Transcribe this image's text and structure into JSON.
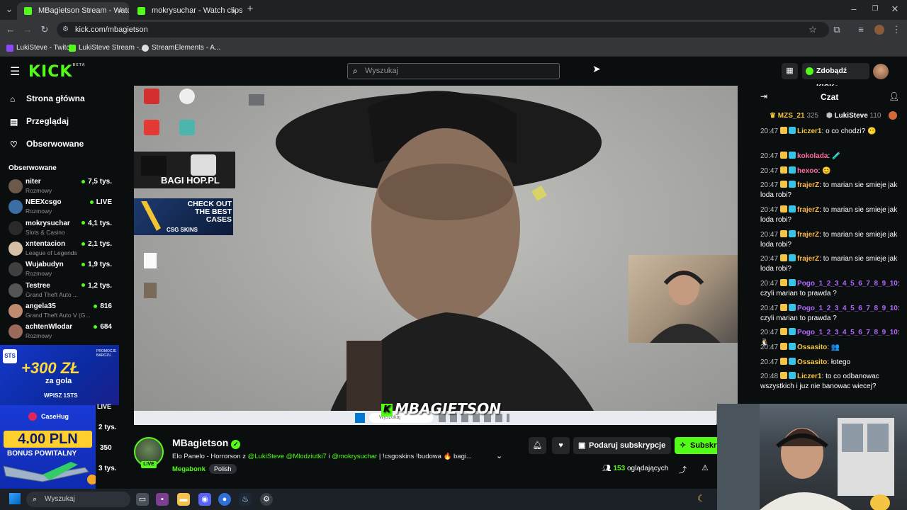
{
  "browser": {
    "tabs": [
      {
        "title": "MBagietson Stream - Watch Liv",
        "active": true
      },
      {
        "title": "mokrysuchar - Watch clips on K",
        "active": false
      }
    ],
    "url": "kick.com/mbagietson",
    "bookmarks": [
      "LukiSteve - Twitch",
      "LukiSteve Stream -...",
      "StreamElements - A..."
    ]
  },
  "header": {
    "logo": "KICK",
    "logo_sup": "BETA",
    "search_placeholder": "Wyszukaj",
    "get_kicks": "Zdobądź KICKs"
  },
  "sidebar": {
    "nav": [
      {
        "label": "Strona główna",
        "icon": "home-icon"
      },
      {
        "label": "Przeglądaj",
        "icon": "browse-icon"
      },
      {
        "label": "Obserwowane",
        "icon": "heart-icon"
      }
    ],
    "followed_title": "Obserwowane",
    "followed": [
      {
        "name": "niter",
        "category": "Rozmowy",
        "viewers": "7,5 tys.",
        "color": "#6b5a4a"
      },
      {
        "name": "NEEXcsgo",
        "category": "Rozmowy",
        "viewers": "LIVE",
        "color": "#3a6ea5"
      },
      {
        "name": "mokrysuchar",
        "category": "Slots & Casino",
        "viewers": "4,1 tys.",
        "color": "#2a2a2a"
      },
      {
        "name": "xntentacion",
        "category": "League of Legends",
        "viewers": "2,1 tys.",
        "color": "#d8c0a8"
      },
      {
        "name": "Wujabudyn",
        "category": "Rozmowy",
        "viewers": "1,9 tys.",
        "color": "#404040"
      },
      {
        "name": "Testree",
        "category": "Grand Theft Auto ...",
        "viewers": "1,2 tys.",
        "color": "#555555"
      },
      {
        "name": "angela35",
        "category": "Grand Theft Auto V (G...",
        "viewers": "816",
        "color": "#c08a70"
      },
      {
        "name": "achtenWlodar",
        "category": "Rozmowy",
        "viewers": "684",
        "color": "#9a6b5a"
      }
    ],
    "partial_viewers": [
      "LIVE",
      "2 tys.",
      "350",
      "3 tys."
    ]
  },
  "ads": {
    "ad1_headline": "+300 ZŁ",
    "ad1_sub": "za gola",
    "ad1_code": "WPISZ 1STS",
    "ad1_promo": "PROMOCJE BAROZU",
    "ad2_brand": "CaseHug",
    "ad2_amount": "4.00 PLN",
    "ad2_sub": "BONUS POWITALNY"
  },
  "video": {
    "overlay_name": "MBAGIETSON",
    "desktop_ad_shop": "BAGI HOP.PL",
    "desktop_ad_cases": "CHECK OUT THE BEST CASES",
    "desktop_ad_brand": "CSG SKINS",
    "inner_search": "Wyszukaj"
  },
  "stream": {
    "name": "MBagietson",
    "live": "LIVE",
    "title_pre": "Elo Panelo - Horrorson z ",
    "title_mentions": "@LukiSteve @Mlodziutki7",
    "title_mid": " i ",
    "title_mention2": "@mokrysuchar",
    "title_post": " | !csgoskins !budowa 🔥 bagi...",
    "category": "Megabonk",
    "language": "Polish",
    "gift_sub": "Podaruj subskrypcje",
    "subscribe": "Subskrybuj",
    "viewers_count": "153",
    "viewers_label": "oglądających"
  },
  "chat": {
    "title": "Czat",
    "pinned": [
      {
        "name": "MZS_21",
        "count": "325",
        "color": "#f5c542"
      },
      {
        "name": "LukiSteve",
        "count": "110",
        "color": "#e8e8e8"
      }
    ],
    "messages": [
      {
        "time": "20:47",
        "user": "Liczer1",
        "color": "#f5c542",
        "text": "o co chodzi? 😶"
      },
      {
        "time": "20:47",
        "user": "kokolada",
        "color": "#ff6b9d",
        "text": "🧪"
      },
      {
        "time": "20:47",
        "user": "hexoo",
        "color": "#ff6b9d",
        "text": "😊"
      },
      {
        "time": "20:47",
        "user": "frajerZ",
        "color": "#ffb347",
        "text": "to marian sie smieje jak loda robi?"
      },
      {
        "time": "20:47",
        "user": "frajerZ",
        "color": "#ffb347",
        "text": "to marian sie smieje jak loda robi?"
      },
      {
        "time": "20:47",
        "user": "frajerZ",
        "color": "#ffb347",
        "text": "to marian sie smieje jak loda robi?"
      },
      {
        "time": "20:47",
        "user": "frajerZ",
        "color": "#ffb347",
        "text": "to marian sie smieje jak loda robi?"
      },
      {
        "time": "20:47",
        "user": "Pogo_1_2_3_4_5_6_7_8_9_10",
        "color": "#b266ff",
        "text": "czyli marian to prawda ?"
      },
      {
        "time": "20:47",
        "user": "Pogo_1_2_3_4_5_6_7_8_9_10",
        "color": "#b266ff",
        "text": "czyli marian to prawda ?"
      },
      {
        "time": "20:47",
        "user": "Pogo_1_2_3_4_5_6_7_8_9_10",
        "color": "#b266ff",
        "text": "🐧"
      },
      {
        "time": "20:47",
        "user": "Ossasito",
        "color": "#f5c542",
        "text": "👥"
      },
      {
        "time": "20:47",
        "user": "Ossasito",
        "color": "#f5c542",
        "text": "łotego"
      },
      {
        "time": "20:48",
        "user": "Liczer1",
        "color": "#f5c542",
        "text": "to co odbanowac wszystkich i juz nie banowac wiecej?"
      }
    ]
  },
  "taskbar": {
    "search": "Wyszukaj"
  },
  "colors": {
    "kick_green": "#53fc18",
    "bg": "#0b0e0f"
  }
}
